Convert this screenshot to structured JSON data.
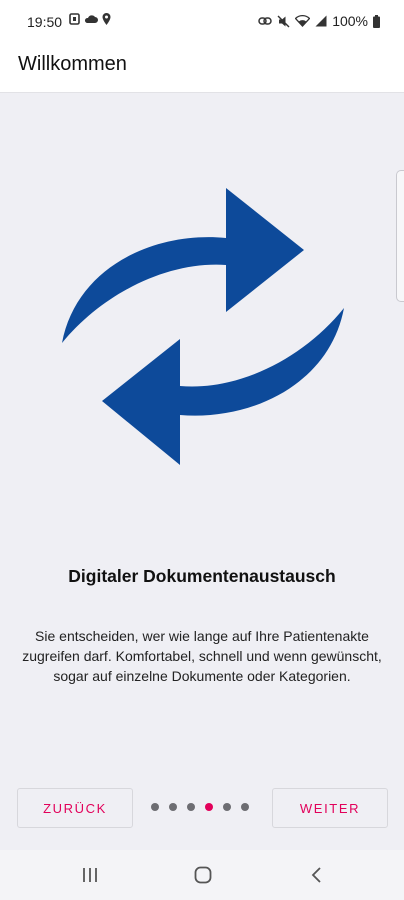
{
  "status_bar": {
    "time": "19:50",
    "battery": "100%",
    "left_icons": [
      "sim-icon",
      "cloud-icon",
      "location-pin-icon"
    ],
    "right_icons": [
      "link-icon",
      "mute-icon",
      "wifi-icon",
      "signal-icon",
      "battery-icon"
    ]
  },
  "app_bar": {
    "title": "Willkommen"
  },
  "slide": {
    "icon": "sync-arrows-icon",
    "title": "Digitaler Dokumentenaustausch",
    "text": "Sie entscheiden, wer wie lange auf Ihre Patientenakte zugreifen darf. Komfortabel, schnell und wenn gewünscht, sogar auf einzelne Dokumente oder Kategorien."
  },
  "pager": {
    "total": 6,
    "current": 4
  },
  "buttons": {
    "back": "ZURÜCK",
    "next": "WEITER"
  },
  "colors": {
    "accent": "#e2005a",
    "icon_blue": "#0d4a9a",
    "background": "#efeff4"
  },
  "system_nav": [
    "recents-icon",
    "home-icon",
    "back-icon"
  ]
}
